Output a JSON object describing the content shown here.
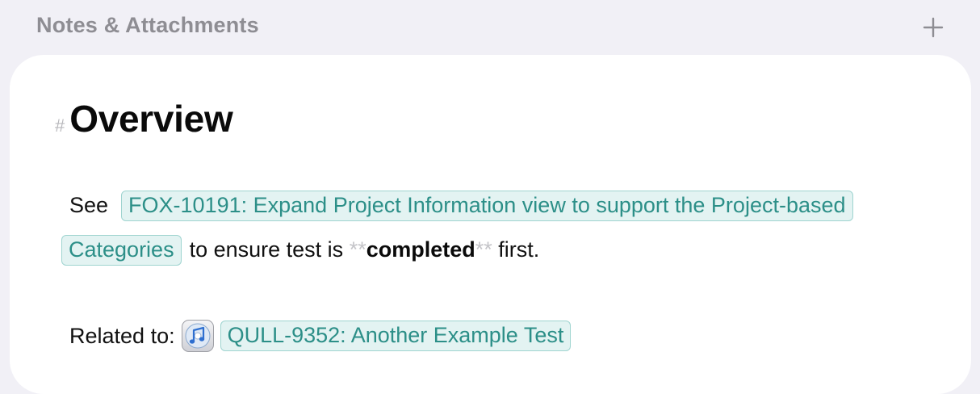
{
  "header": {
    "title": "Notes & Attachments",
    "add_icon": "plus-icon"
  },
  "note": {
    "heading_marker": "#",
    "heading": "Overview",
    "paragraph": {
      "prefix": "See",
      "link1": "FOX-10191: Expand Project Information view to support the Project-based",
      "link1_continued": "Categories",
      "middle": "to ensure test is",
      "bold_marker_open": "**",
      "bold_text": "completed",
      "bold_marker_close": "**",
      "suffix": "first."
    },
    "related": {
      "label": "Related to:",
      "icon": "itunes-music-icon",
      "link": "QULL-9352: Another Example Test"
    }
  },
  "colors": {
    "background": "#f1f0f6",
    "card": "#ffffff",
    "chip_bg": "#e3f3f2",
    "chip_border": "#9fd4d0",
    "chip_text": "#2c8f88",
    "header_text": "#8e8d93"
  }
}
